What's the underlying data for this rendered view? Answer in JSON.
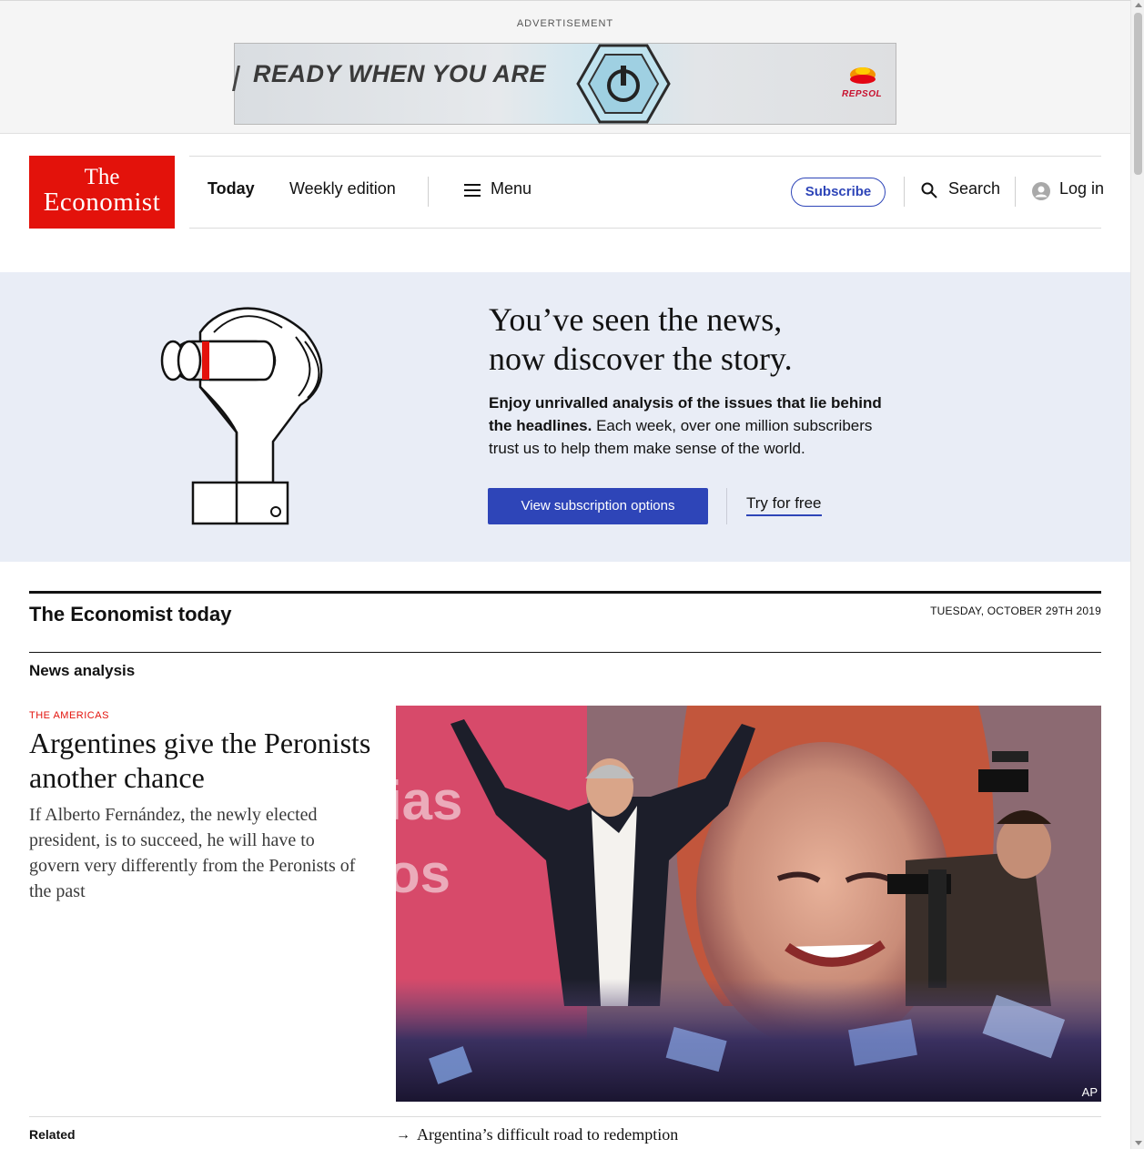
{
  "advertisement": {
    "label": "ADVERTISEMENT",
    "headline": "READY WHEN YOU ARE",
    "brand": "REPSOL"
  },
  "header": {
    "logo_line1": "The",
    "logo_line2": "Economist",
    "nav_today": "Today",
    "nav_weekly": "Weekly edition",
    "nav_menu": "Menu",
    "subscribe": "Subscribe",
    "search": "Search",
    "login": "Log in"
  },
  "promo": {
    "heading_line1": "You’ve seen the news,",
    "heading_line2": "now discover the story.",
    "body_bold": "Enjoy unrivalled analysis of the issues that lie behind the headlines.",
    "body_rest": " Each week, over one million subscribers trust us to help them make sense of the world.",
    "primary_button": "View subscription options",
    "secondary_link": "Try for free"
  },
  "today": {
    "title": "The Economist today",
    "date": "TUESDAY, OCTOBER 29TH 2019",
    "section_label": "News analysis"
  },
  "article": {
    "flytitle": "THE AMERICAS",
    "headline": "Argentines give the Peronists another chance",
    "rubric": "If Alberto Fernández, the newly elected president, is to succeed, he will have to govern very differently from the Peronists of the past",
    "photo_credit": "AP"
  },
  "related": {
    "label": "Related",
    "items": [
      "Argentina’s difficult road to redemption"
    ]
  },
  "colors": {
    "brand_red": "#e3120b",
    "accent_blue": "#2e45b8",
    "promo_bg": "#e9edf6"
  }
}
